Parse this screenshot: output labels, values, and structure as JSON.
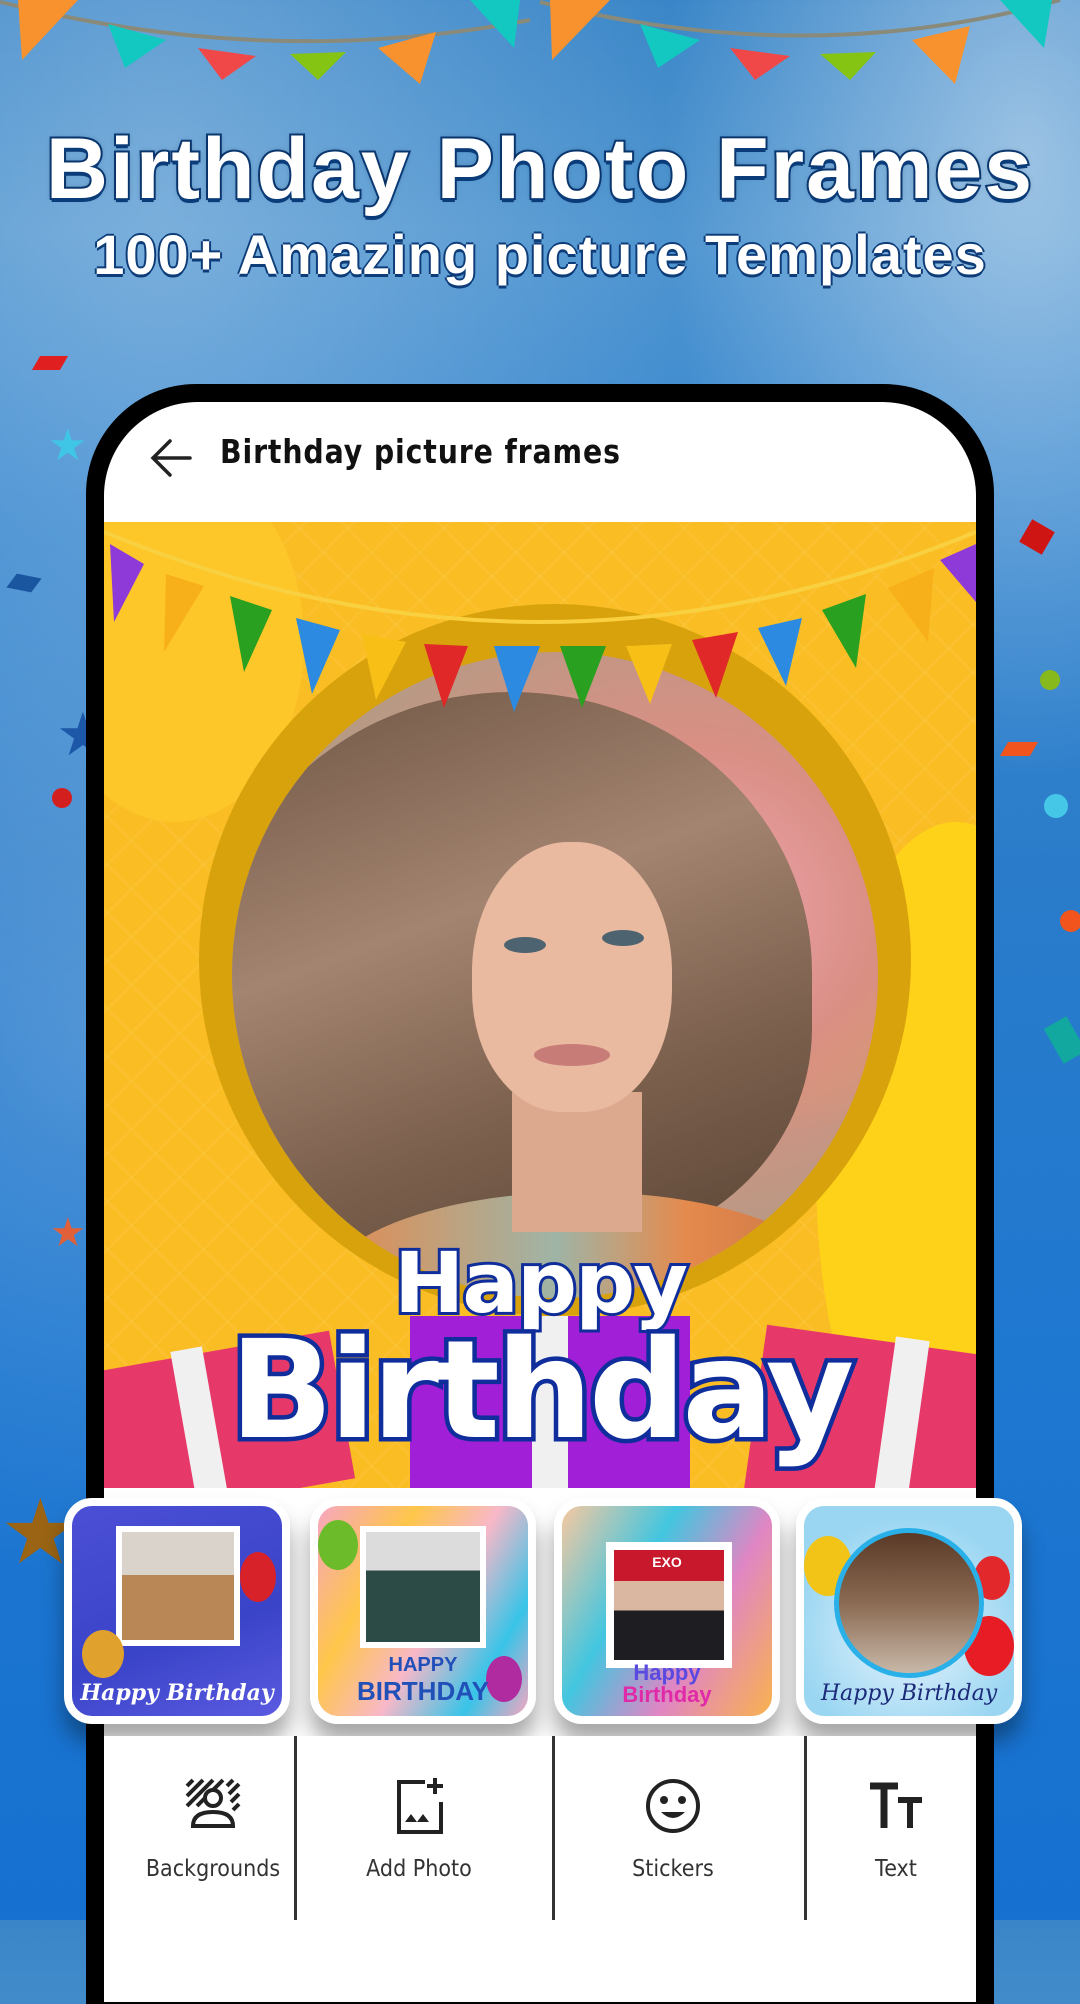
{
  "hero": {
    "title": "Birthday Photo Frames",
    "subtitle": "100+ Amazing picture Templates"
  },
  "app": {
    "title": "Birthday picture frames",
    "back_icon": "arrow-left-icon"
  },
  "editor": {
    "greeting_line1": "Happy",
    "greeting_line2": "Birthday",
    "colors": {
      "background": "#fbbd24",
      "ring": "#d8a20c",
      "text_outline": "#0f2e9c"
    }
  },
  "templates": [
    {
      "caption": "Happy Birthday",
      "style": "blue-balloons"
    },
    {
      "caption_line1": "HAPPY",
      "caption_line2": "BIRTHDAY",
      "style": "pink-waves"
    },
    {
      "caption_line1": "Happy",
      "caption_line2": "Birthday",
      "badge": "EXO",
      "style": "rainbow-blur"
    },
    {
      "caption": "Happy Birthday",
      "style": "balloons-circle"
    }
  ],
  "toolbar": {
    "items": [
      {
        "label": "Backgrounds",
        "icon": "backgrounds-icon"
      },
      {
        "label": "Add Photo",
        "icon": "add-photo-icon"
      },
      {
        "label": "Stickers",
        "icon": "smiley-icon"
      },
      {
        "label": "Text",
        "icon": "text-icon"
      }
    ]
  },
  "colors": {
    "page_background": "#2a7cca",
    "phone_frame": "#000000",
    "title_outline": "#0b3c7a"
  }
}
